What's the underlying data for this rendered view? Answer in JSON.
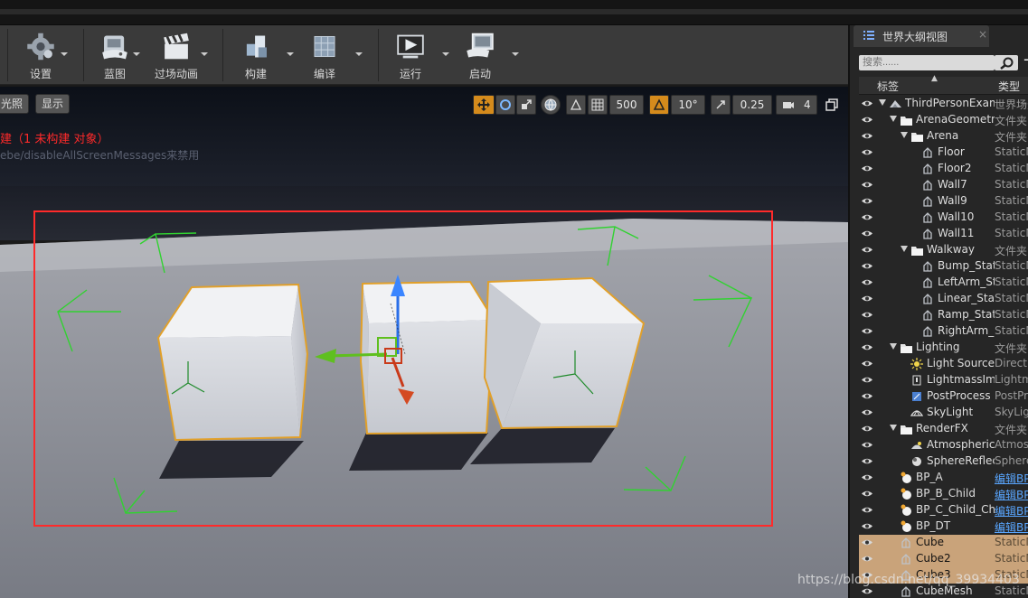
{
  "toolbar": {
    "buttons": [
      {
        "label": "设置",
        "icon": "gear-icon"
      },
      {
        "label": "蓝图",
        "icon": "gamepad-blueprint-icon"
      },
      {
        "label": "过场动画",
        "icon": "clapperboard-icon"
      },
      {
        "label": "构建",
        "icon": "build-blocks-icon"
      },
      {
        "label": "编译",
        "icon": "compile-cube-icon"
      },
      {
        "label": "运行",
        "icon": "play-monitor-icon"
      },
      {
        "label": "启动",
        "icon": "launch-console-icon"
      }
    ]
  },
  "viewport": {
    "left_buttons": [
      "光照",
      "显示"
    ],
    "warning_text": "建（1 未构建 对象）",
    "hint_text": "ebe/disableAllScreenMessages来禁用",
    "grid_snap_value": "500",
    "rotation_snap_value": "10°",
    "scale_snap_value": "0.25",
    "camera_speed_value": "4",
    "accent_color": "#d58b1c",
    "selection_rect_color": "#ff2a2a"
  },
  "outliner": {
    "tab_title": "世界大纲视图",
    "tab_close": "×",
    "search_placeholder": "搜索......",
    "add_button": "+",
    "col_label": "标签",
    "col_type": "类型",
    "rows": [
      {
        "name": "ThirdPersonExam",
        "type": "世界场景",
        "depth": 0,
        "arrow": true,
        "icon": "world-icon"
      },
      {
        "name": "ArenaGeometry",
        "type": "文件夹",
        "depth": 1,
        "arrow": true,
        "icon": "folder-icon"
      },
      {
        "name": "Arena",
        "type": "文件夹",
        "depth": 2,
        "arrow": true,
        "icon": "folder-icon"
      },
      {
        "name": "Floor",
        "type": "StaticMesh",
        "depth": 3,
        "icon": "static-mesh-icon"
      },
      {
        "name": "Floor2",
        "type": "StaticMesh",
        "depth": 3,
        "icon": "static-mesh-icon"
      },
      {
        "name": "Wall7",
        "type": "StaticMesh",
        "depth": 3,
        "icon": "static-mesh-icon"
      },
      {
        "name": "Wall9",
        "type": "StaticMesh",
        "depth": 3,
        "icon": "static-mesh-icon"
      },
      {
        "name": "Wall10",
        "type": "StaticMesh",
        "depth": 3,
        "icon": "static-mesh-icon"
      },
      {
        "name": "Wall11",
        "type": "StaticMesh",
        "depth": 3,
        "icon": "static-mesh-icon"
      },
      {
        "name": "Walkway",
        "type": "文件夹",
        "depth": 2,
        "arrow": true,
        "icon": "folder-icon"
      },
      {
        "name": "Bump_Stat",
        "type": "StaticMesh",
        "depth": 3,
        "icon": "static-mesh-icon"
      },
      {
        "name": "LeftArm_St",
        "type": "StaticMesh",
        "depth": 3,
        "icon": "static-mesh-icon"
      },
      {
        "name": "Linear_Stat",
        "type": "StaticMesh",
        "depth": 3,
        "icon": "static-mesh-icon"
      },
      {
        "name": "Ramp_Stat",
        "type": "StaticMesh",
        "depth": 3,
        "icon": "static-mesh-icon"
      },
      {
        "name": "RightArm_",
        "type": "StaticMesh",
        "depth": 3,
        "icon": "static-mesh-icon"
      },
      {
        "name": "Lighting",
        "type": "文件夹",
        "depth": 1,
        "arrow": true,
        "icon": "folder-icon"
      },
      {
        "name": "Light Source",
        "type": "Directional",
        "depth": 2,
        "icon": "sun-icon"
      },
      {
        "name": "LightmassIm",
        "type": "Lightmass",
        "depth": 2,
        "icon": "lightmass-icon"
      },
      {
        "name": "PostProcess",
        "type": "PostProcess",
        "depth": 2,
        "icon": "postprocess-icon"
      },
      {
        "name": "SkyLight",
        "type": "SkyLight",
        "depth": 2,
        "icon": "skylight-icon"
      },
      {
        "name": "RenderFX",
        "type": "文件夹",
        "depth": 1,
        "arrow": true,
        "icon": "folder-icon"
      },
      {
        "name": "Atmospheric",
        "type": "Atmosphere",
        "depth": 2,
        "icon": "fog-icon"
      },
      {
        "name": "SphereReflec",
        "type": "SphereRefl",
        "depth": 2,
        "icon": "sphere-reflection-icon"
      },
      {
        "name": "BP_A",
        "type": "编辑BP",
        "depth": 1,
        "link": true,
        "icon": "actor-icon"
      },
      {
        "name": "BP_B_Child",
        "type": "编辑BP",
        "depth": 1,
        "link": true,
        "icon": "actor-icon"
      },
      {
        "name": "BP_C_Child_Ch",
        "type": "编辑BP",
        "depth": 1,
        "link": true,
        "icon": "actor-icon"
      },
      {
        "name": "BP_DT",
        "type": "编辑BP",
        "depth": 1,
        "link": true,
        "icon": "actor-icon"
      },
      {
        "name": "Cube",
        "type": "StaticMesh",
        "depth": 1,
        "selected": true,
        "icon": "static-mesh-icon"
      },
      {
        "name": "Cube2",
        "type": "StaticMesh",
        "depth": 1,
        "selected": true,
        "icon": "static-mesh-icon"
      },
      {
        "name": "Cube3",
        "type": "StaticMesh",
        "depth": 1,
        "selected": true,
        "icon": "static-mesh-icon"
      },
      {
        "name": "CubeMesh",
        "type": "StaticMesh",
        "depth": 1,
        "icon": "static-mesh-icon"
      }
    ]
  },
  "watermark": "https://blog.csdn.net/qq_39934403"
}
